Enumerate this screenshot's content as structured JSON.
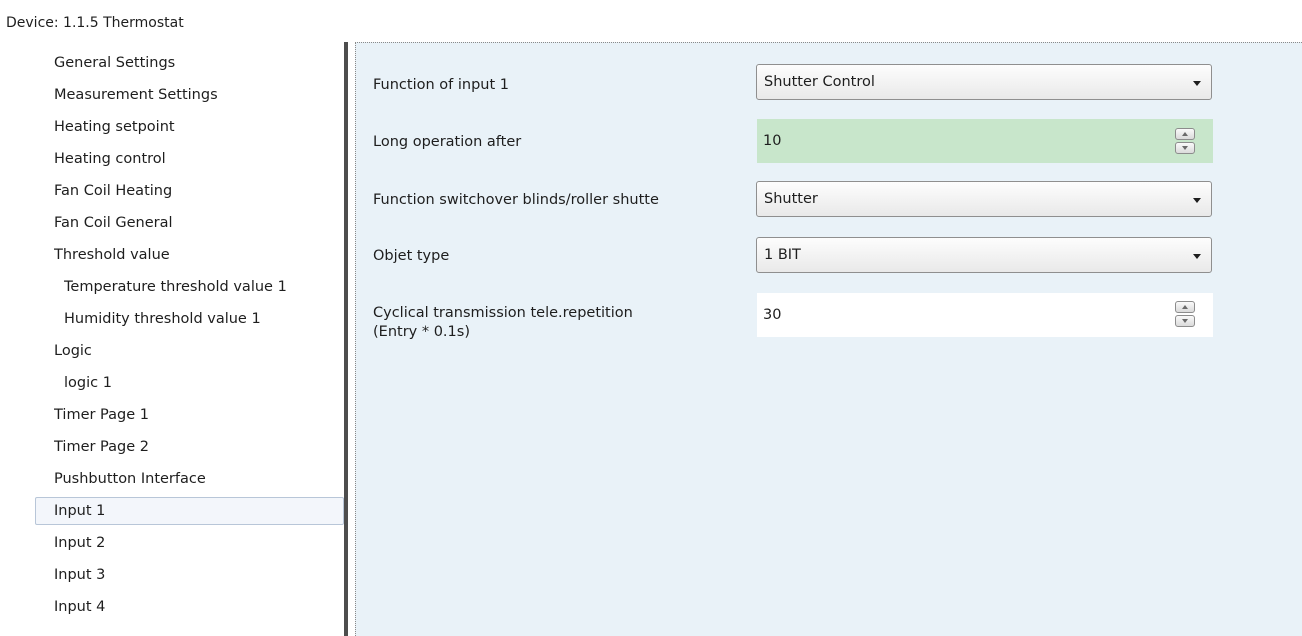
{
  "window": {
    "title": "Device: 1.1.5  Thermostat"
  },
  "sidebar": {
    "items": [
      {
        "label": "General Settings"
      },
      {
        "label": "Measurement Settings"
      },
      {
        "label": "Heating setpoint"
      },
      {
        "label": "Heating control"
      },
      {
        "label": "Fan Coil Heating"
      },
      {
        "label": "Fan Coil General"
      },
      {
        "label": "Threshold value"
      },
      {
        "label": "Temperature threshold value 1"
      },
      {
        "label": "Humidity threshold value 1"
      },
      {
        "label": "Logic"
      },
      {
        "label": "logic 1"
      },
      {
        "label": "Timer Page 1"
      },
      {
        "label": "Timer Page 2"
      },
      {
        "label": "Pushbutton Interface"
      },
      {
        "label": "Input 1"
      },
      {
        "label": "Input 2"
      },
      {
        "label": "Input 3"
      },
      {
        "label": "Input 4"
      }
    ],
    "selected": "Input 1"
  },
  "params": {
    "function_label": "Function of input 1",
    "function_value": "Shutter Control",
    "long_op_label": "Long operation after",
    "long_op_value": "10",
    "switchover_label": "Function switchover blinds/roller shutte",
    "switchover_value": "Shutter",
    "objtype_label": "Objet type",
    "objtype_value": "1 BIT",
    "cyclical_label_line1": "Cyclical transmission tele.repetition",
    "cyclical_label_line2": "(Entry * 0.1s)",
    "cyclical_value": "30"
  },
  "colors": {
    "panel_bg": "#e9f2f8",
    "highlight_field": "#c8e6cb",
    "splitter": "#4d4d4d"
  }
}
